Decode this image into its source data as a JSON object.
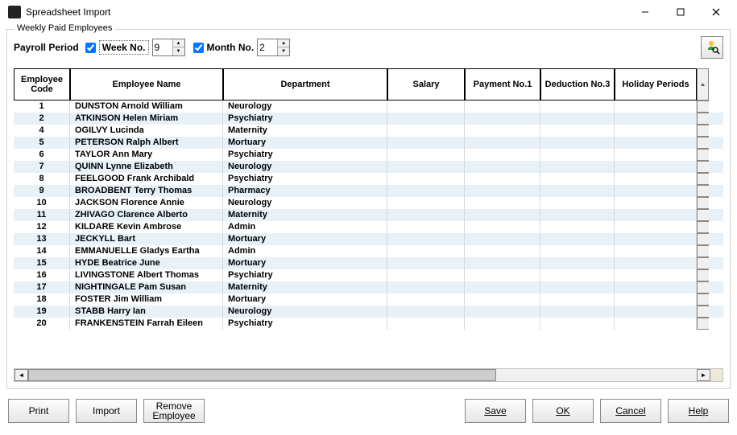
{
  "window_title": "Spreadsheet Import",
  "group_title": "Weekly Paid Employees",
  "period": {
    "label": "Payroll Period",
    "week_checked": true,
    "week_label": "Week No.",
    "week_value": "9",
    "month_checked": true,
    "month_label": "Month No.",
    "month_value": "2"
  },
  "columns": {
    "code": "Employee Code",
    "name": "Employee Name",
    "dept": "Department",
    "salary": "Salary",
    "payment": "Payment No.1",
    "deduction": "Deduction No.3",
    "holiday": "Holiday Periods"
  },
  "rows": [
    {
      "code": "1",
      "name": "DUNSTON Arnold William",
      "dept": "Neurology",
      "salary": "",
      "payment": "",
      "deduction": "",
      "holiday": ""
    },
    {
      "code": "2",
      "name": "ATKINSON Helen Miriam",
      "dept": "Psychiatry",
      "salary": "",
      "payment": "",
      "deduction": "",
      "holiday": ""
    },
    {
      "code": "4",
      "name": "OGILVY Lucinda",
      "dept": "Maternity",
      "salary": "",
      "payment": "",
      "deduction": "",
      "holiday": ""
    },
    {
      "code": "5",
      "name": "PETERSON Ralph Albert",
      "dept": "Mortuary",
      "salary": "",
      "payment": "",
      "deduction": "",
      "holiday": ""
    },
    {
      "code": "6",
      "name": "TAYLOR Ann Mary",
      "dept": "Psychiatry",
      "salary": "",
      "payment": "",
      "deduction": "",
      "holiday": ""
    },
    {
      "code": "7",
      "name": "QUINN Lynne Elizabeth",
      "dept": "Neurology",
      "salary": "",
      "payment": "",
      "deduction": "",
      "holiday": ""
    },
    {
      "code": "8",
      "name": "FEELGOOD Frank Archibald",
      "dept": "Psychiatry",
      "salary": "",
      "payment": "",
      "deduction": "",
      "holiday": ""
    },
    {
      "code": "9",
      "name": "BROADBENT Terry Thomas",
      "dept": "Pharmacy",
      "salary": "",
      "payment": "",
      "deduction": "",
      "holiday": ""
    },
    {
      "code": "10",
      "name": "JACKSON Florence Annie",
      "dept": "Neurology",
      "salary": "",
      "payment": "",
      "deduction": "",
      "holiday": ""
    },
    {
      "code": "11",
      "name": "ZHIVAGO Clarence Alberto",
      "dept": "Maternity",
      "salary": "",
      "payment": "",
      "deduction": "",
      "holiday": ""
    },
    {
      "code": "12",
      "name": "KILDARE Kevin Ambrose",
      "dept": "Admin",
      "salary": "",
      "payment": "",
      "deduction": "",
      "holiday": ""
    },
    {
      "code": "13",
      "name": "JECKYLL Bart",
      "dept": "Mortuary",
      "salary": "",
      "payment": "",
      "deduction": "",
      "holiday": ""
    },
    {
      "code": "14",
      "name": "EMMANUELLE Gladys Eartha",
      "dept": "Admin",
      "salary": "",
      "payment": "",
      "deduction": "",
      "holiday": ""
    },
    {
      "code": "15",
      "name": "HYDE Beatrice June",
      "dept": "Mortuary",
      "salary": "",
      "payment": "",
      "deduction": "",
      "holiday": ""
    },
    {
      "code": "16",
      "name": "LIVINGSTONE Albert Thomas",
      "dept": "Psychiatry",
      "salary": "",
      "payment": "",
      "deduction": "",
      "holiday": ""
    },
    {
      "code": "17",
      "name": "NIGHTINGALE Pam Susan",
      "dept": "Maternity",
      "salary": "",
      "payment": "",
      "deduction": "",
      "holiday": ""
    },
    {
      "code": "18",
      "name": "FOSTER Jim William",
      "dept": "Mortuary",
      "salary": "",
      "payment": "",
      "deduction": "",
      "holiday": ""
    },
    {
      "code": "19",
      "name": "STABB Harry Ian",
      "dept": "Neurology",
      "salary": "",
      "payment": "",
      "deduction": "",
      "holiday": ""
    },
    {
      "code": "20",
      "name": "FRANKENSTEIN Farrah Eileen",
      "dept": "Psychiatry",
      "salary": "",
      "payment": "",
      "deduction": "",
      "holiday": ""
    }
  ],
  "buttons": {
    "print": "Print",
    "import": "Import",
    "remove": "Remove Employee",
    "save": "Save",
    "ok": "OK",
    "cancel": "Cancel",
    "help": "Help"
  }
}
